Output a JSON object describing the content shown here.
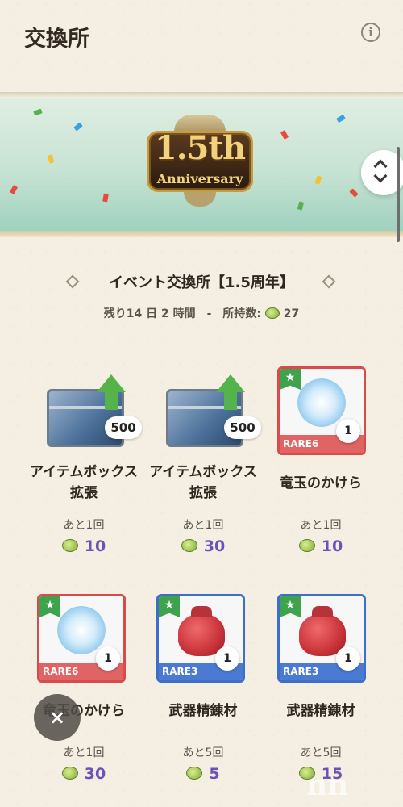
{
  "header": {
    "title": "交換所",
    "info_icon_glyph": "i"
  },
  "banner": {
    "emblem_main": "1.5th",
    "emblem_sub": "Anniversary"
  },
  "event": {
    "title": "イベント交換所【1.5周年】",
    "remaining": "残り14 日 2 時間",
    "separator": "-",
    "owned_label": "所持数:",
    "owned_count": "27"
  },
  "items": [
    {
      "name": "アイテムボックス拡張",
      "badge": "500",
      "remain": "あと1回",
      "price": "10",
      "icon": "item-box-chest"
    },
    {
      "name": "アイテムボックス拡張",
      "badge": "500",
      "remain": "あと1回",
      "price": "30",
      "icon": "item-box-chest"
    },
    {
      "name": "竜玉のかけら",
      "badge": "1",
      "rarity": "RARE6",
      "remain": "あと1回",
      "price": "10",
      "icon": "dragon-gem"
    },
    {
      "name": "竜玉のかけら",
      "badge": "1",
      "rarity": "RARE6",
      "remain": "あと1回",
      "price": "30",
      "icon": "dragon-gem"
    },
    {
      "name": "武器精錬材",
      "badge": "1",
      "rarity": "RARE3",
      "remain": "あと5回",
      "price": "5",
      "icon": "refining-bag"
    },
    {
      "name": "武器精錬材",
      "badge": "1",
      "rarity": "RARE3",
      "remain": "あと5回",
      "price": "15",
      "icon": "refining-bag"
    }
  ],
  "star_glyph": "★",
  "close_glyph": "×",
  "colors": {
    "rare6": "#d94a4a",
    "rare3": "#3d6fc9",
    "price": "#6b52b8",
    "accent_green": "#3fa34d"
  }
}
